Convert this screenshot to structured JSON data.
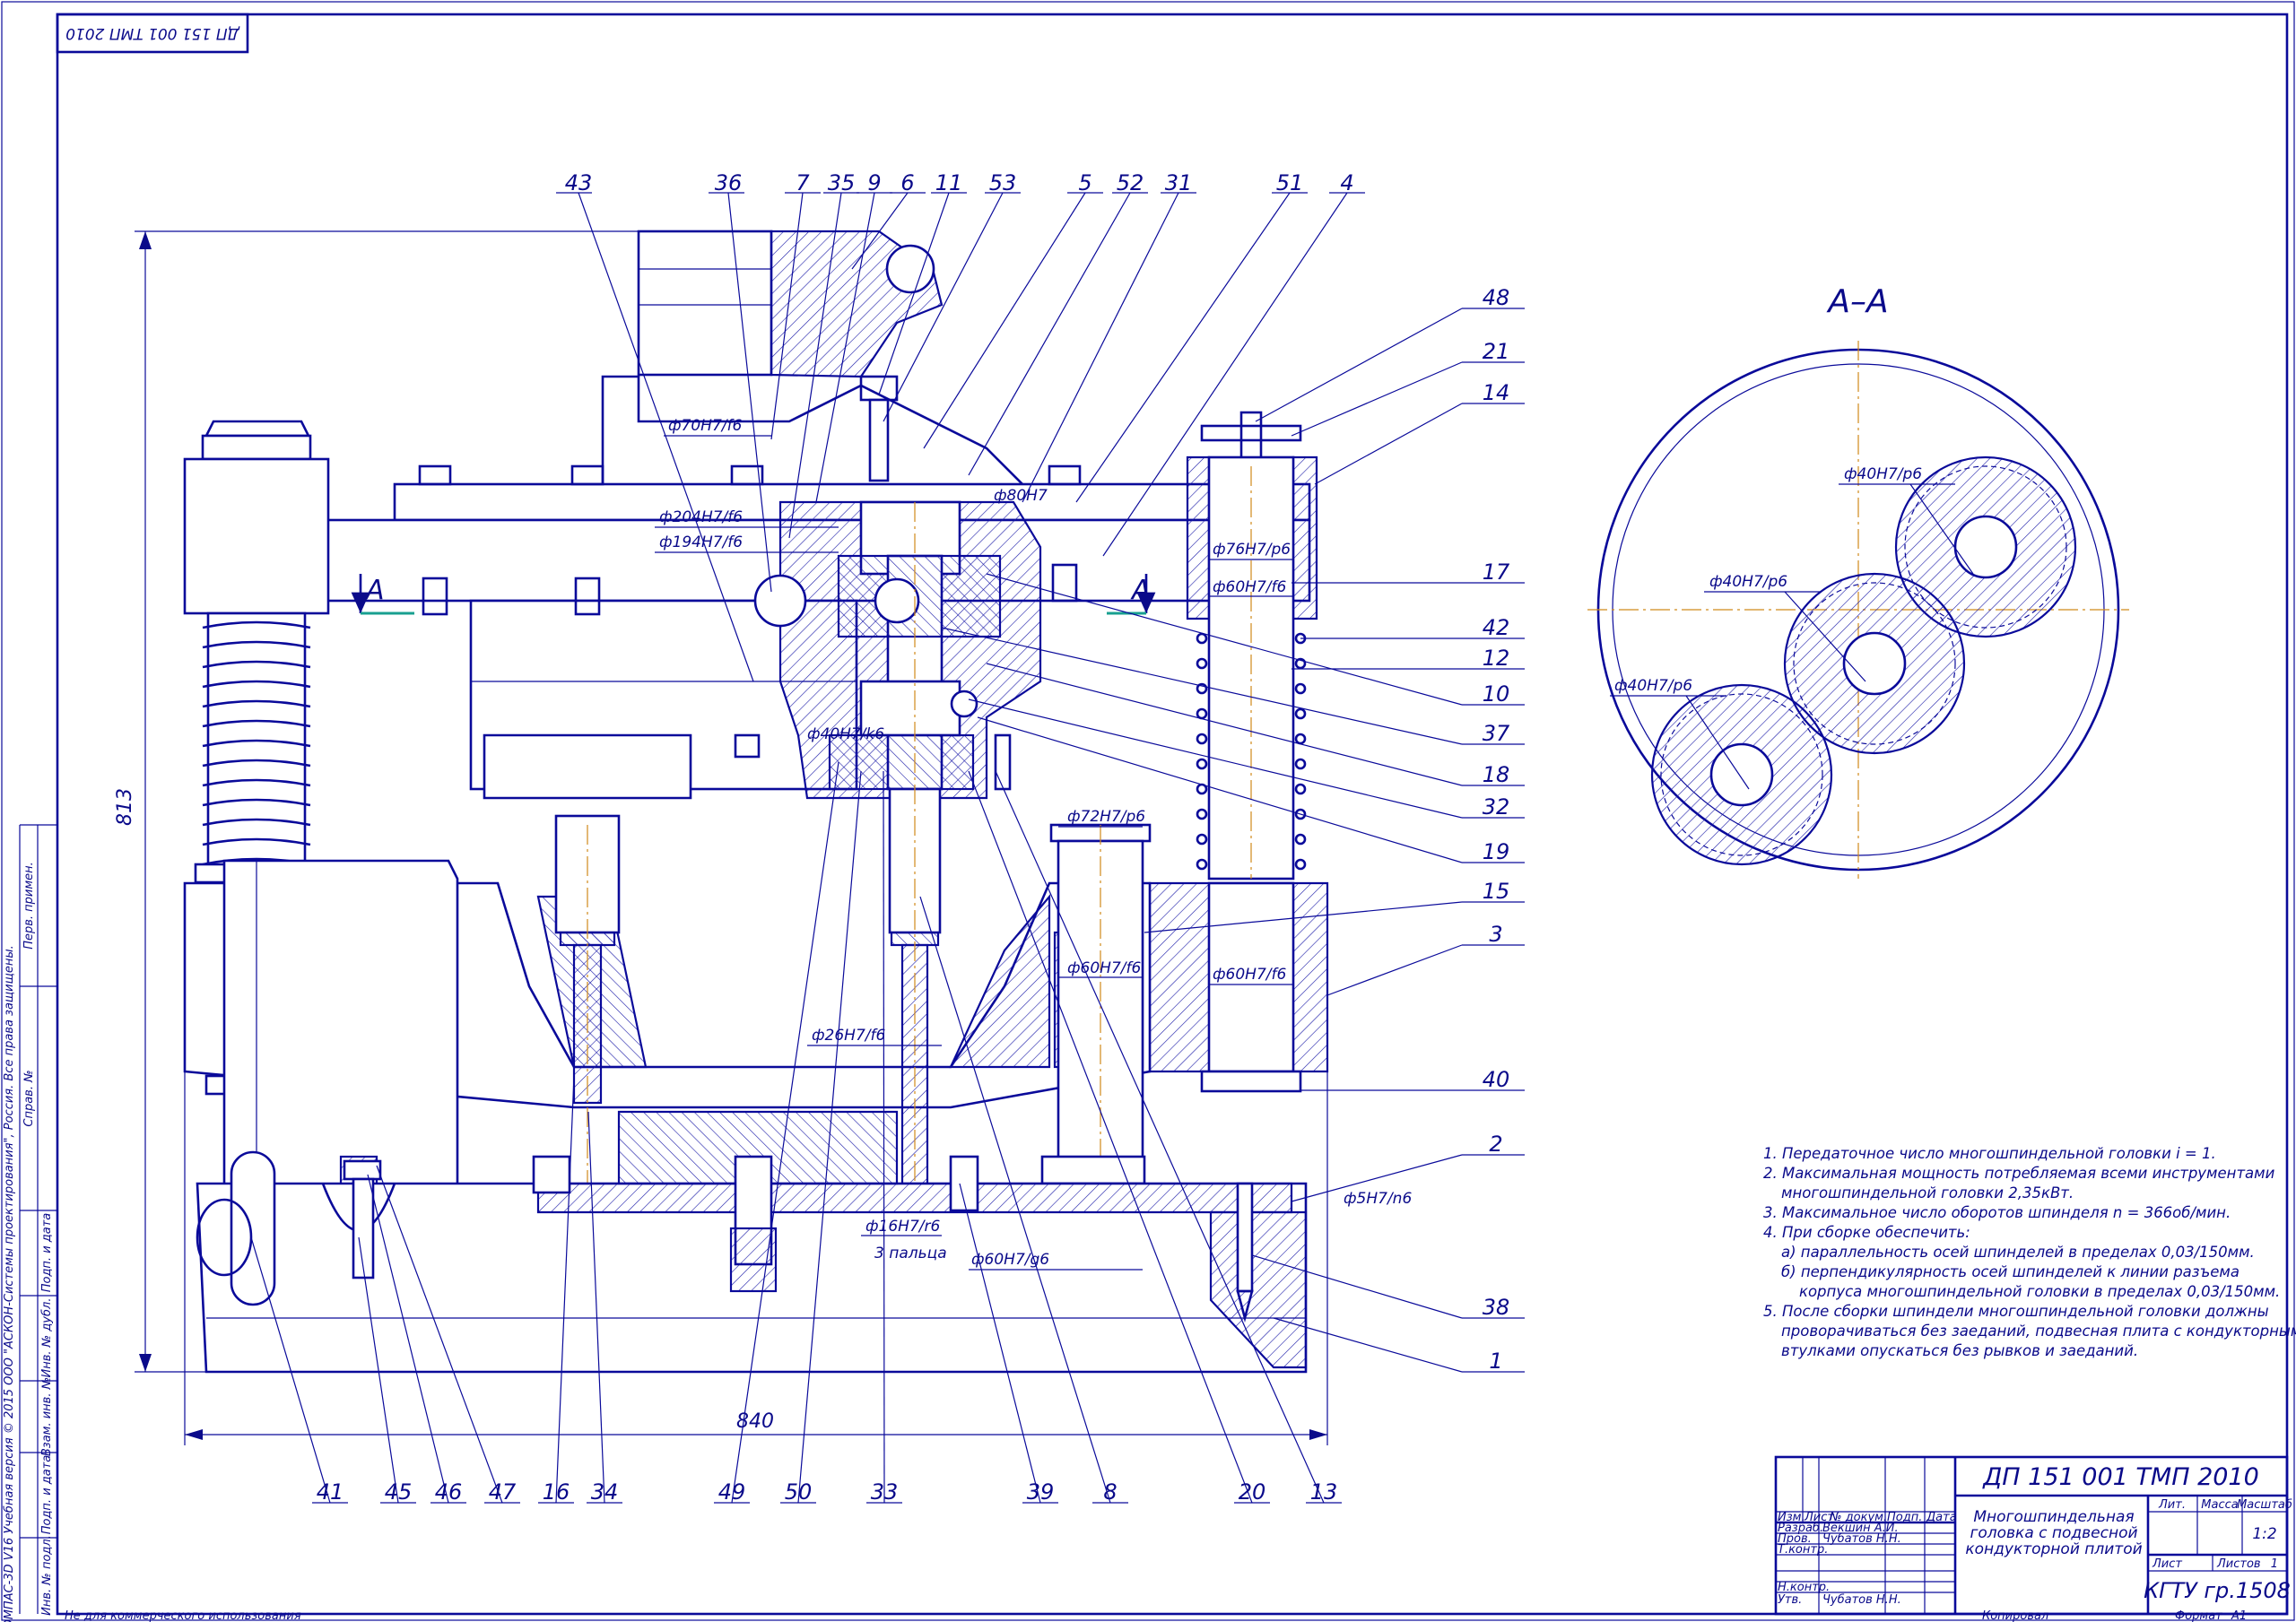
{
  "stamp": "ДП 151 001 ТМП 2010",
  "section_label": "А–А",
  "section_marks": [
    "А",
    "А"
  ],
  "callouts": {
    "top": [
      "43",
      "36",
      "7",
      "35",
      "9",
      "6",
      "11",
      "53",
      "5",
      "52",
      "31",
      "51",
      "4"
    ],
    "right": [
      "48",
      "21",
      "14",
      "17",
      "42",
      "12",
      "10",
      "37",
      "18",
      "32",
      "19",
      "15",
      "3",
      "40",
      "2",
      "38",
      "1"
    ],
    "bottom": [
      "41",
      "45",
      "46",
      "47",
      "16",
      "34",
      "49",
      "50",
      "33",
      "39",
      "8",
      "20",
      "13"
    ]
  },
  "fits": {
    "f70": "ф70Н7/f6",
    "f204": "ф204Н7/f6",
    "f194": "ф194Н7/f6",
    "f80": "ф80Н7",
    "f40k6": "ф40Н7/k6",
    "f76": "ф76Н7/р6",
    "f60a": "ф60Н7/f6",
    "f72": "ф72Н7/р6",
    "f60b": "ф60Н7/f6",
    "f60c": "ф60Н7/f6",
    "f26": "ф26Н7/f6",
    "f16": "ф16Н7/r6",
    "fingers": "3 пальца",
    "f60g6": "ф60Н7/g6",
    "f5": "ф5Н7/n6",
    "sec1": "ф40Н7/р6",
    "sec2": "ф40Н7/р6",
    "sec3": "ф40Н7/р6"
  },
  "dimensions": {
    "height": "813",
    "width": "840"
  },
  "notes": [
    "1. Передаточное число многошпиндельной головки i = 1.",
    "2. Максимальная мощность потребляемая всеми инструментами",
    "многошпиндельной головки 2,35кВт.",
    "3. Максимальное число оборотов шпинделя n = 366об/мин.",
    "4. При сборке обеспечить:",
    "а) параллельность осей шпинделей в пределах 0,03/150мм.",
    "б) перпендикулярность осей шпинделей к линии разъема",
    "корпуса многошпиндельной головки в пределах 0,03/150мм.",
    "5. После сборки шпиндели многошпиндельной головки должны",
    "проворачиваться без заеданий, подвесная плита с кондукторными",
    "втулками опускаться без рывков и заеданий."
  ],
  "side_strip": {
    "perv": "Перв. примен.",
    "sprav": "Справ. №",
    "podp1": "Подп. и дата",
    "inv_dubl": "Инв. № дубл.",
    "vzam": "Взам. инв. №",
    "podp2": "Подп. и дата",
    "inv_podl": "Инв. № подл.",
    "kompas": "КОМПАС-3D V16 Учебная версия © 2015 ООО \"АСКОН-Системы проектирования\", Россия. Все права защищены."
  },
  "footer": {
    "noncommercial": "Не для коммерческого использования",
    "copied": "Копировал",
    "format_label": "Формат",
    "format_value": "А1"
  },
  "title_block": {
    "doc_number": "ДП 151 001 ТМП 2010",
    "title_line1": "Многошпиндельная",
    "title_line2": "головка с подвесной",
    "title_line3": "кондукторной плитой",
    "col_izm": "Изм.",
    "col_list": "Лист",
    "col_doc": "№ докум.",
    "col_podp": "Подп.",
    "col_data": "Дата",
    "razrab": "Разраб.",
    "razrab_name": "Векшин А.И.",
    "prov": "Пров.",
    "prov_name": "Чубатов Н.Н.",
    "tkontr": "Т.контр.",
    "nkontr": "Н.контр.",
    "utv": "Утв.",
    "utv_name": "Чубатов Н.Н.",
    "lit": "Лит.",
    "massa": "Масса",
    "masshtab": "Масштаб",
    "scale_value": "1:2",
    "list_label": "Лист",
    "listov_label": "Листов",
    "listov_value": "1",
    "org": "КГТУ гр.1508"
  }
}
